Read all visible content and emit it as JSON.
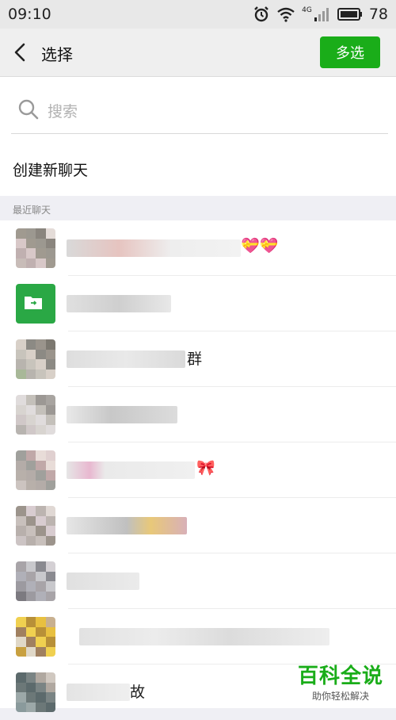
{
  "status_bar": {
    "time": "09:10",
    "network": "4G",
    "battery": "78"
  },
  "header": {
    "title": "选择",
    "multi_select_label": "多选"
  },
  "search": {
    "placeholder": "搜索"
  },
  "new_chat_label": "创建新聊天",
  "recent_section_label": "最近聊天",
  "recent_chats": [
    {
      "visible_name_tail": "",
      "emoji": "💝💝"
    },
    {
      "visible_name_tail": "",
      "emoji": ""
    },
    {
      "visible_name_tail": "群",
      "emoji": ""
    },
    {
      "visible_name_tail": "",
      "emoji": ""
    },
    {
      "visible_name_tail": "",
      "emoji": "🎀"
    },
    {
      "visible_name_tail": "",
      "emoji": ""
    },
    {
      "visible_name_tail": "",
      "emoji": ""
    },
    {
      "visible_name_tail": "",
      "emoji": ""
    },
    {
      "visible_name_tail": "故",
      "emoji": ""
    }
  ],
  "watermark": {
    "title": "百科全说",
    "subtitle": "助你轻松解决"
  },
  "colors": {
    "accent": "#1aad19",
    "background": "#efeff4",
    "status_bar": "#e8e8e8"
  }
}
